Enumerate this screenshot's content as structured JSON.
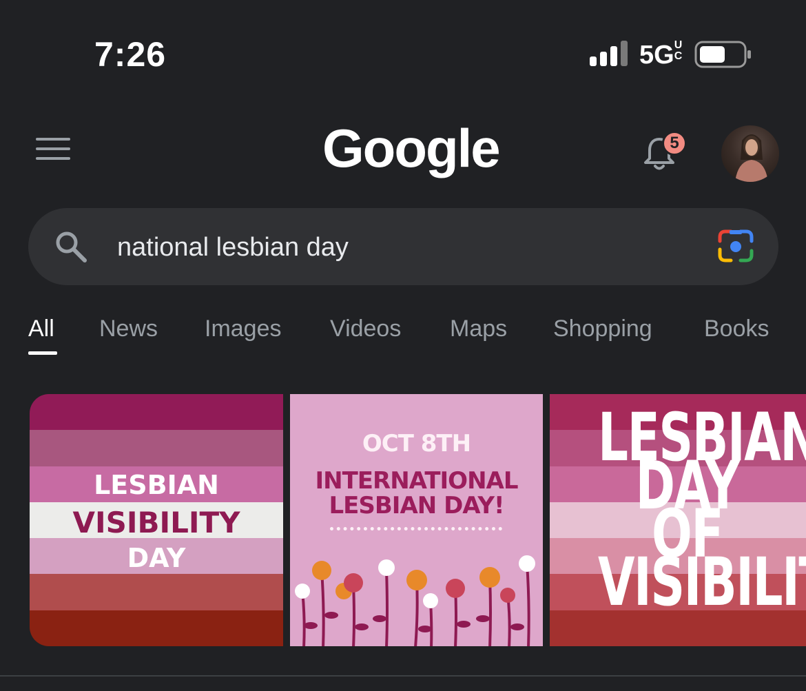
{
  "status_bar": {
    "time": "7:26",
    "network": "5G",
    "network_suffix": "UC"
  },
  "header": {
    "logo": "Google",
    "notification_count": "5"
  },
  "search": {
    "query": "national lesbian day"
  },
  "tabs": [
    {
      "label": "All",
      "active": true
    },
    {
      "label": "News",
      "active": false
    },
    {
      "label": "Images",
      "active": false
    },
    {
      "label": "Videos",
      "active": false
    },
    {
      "label": "Maps",
      "active": false
    },
    {
      "label": "Shopping",
      "active": false
    },
    {
      "label": "Books",
      "active": false
    }
  ],
  "images": [
    {
      "line1": "LESBIAN",
      "line2": "VISIBILITY",
      "line3": "DAY",
      "stripe_colors": [
        "#911b57",
        "#a8577f",
        "#c76ba3",
        "#ececea",
        "#d4a0c1",
        "#b04d4d",
        "#8a2212"
      ]
    },
    {
      "date": "OCT 8TH",
      "title_line1": "INTERNATIONAL",
      "title_line2": "LESBIAN DAY!"
    },
    {
      "line1": "LESBIAN",
      "line2": "DAY",
      "line3": "OF",
      "line4": "VISIBILITY",
      "stripe_colors": [
        "#a62a5a",
        "#b5507e",
        "#c9699a",
        "#e7c1d2",
        "#d98fa5",
        "#c0505b",
        "#a3312f"
      ]
    }
  ],
  "colors": {
    "background": "#202124",
    "search_bg": "#303134",
    "badge": "#f28b82",
    "tab_inactive": "#9aa0a6"
  }
}
